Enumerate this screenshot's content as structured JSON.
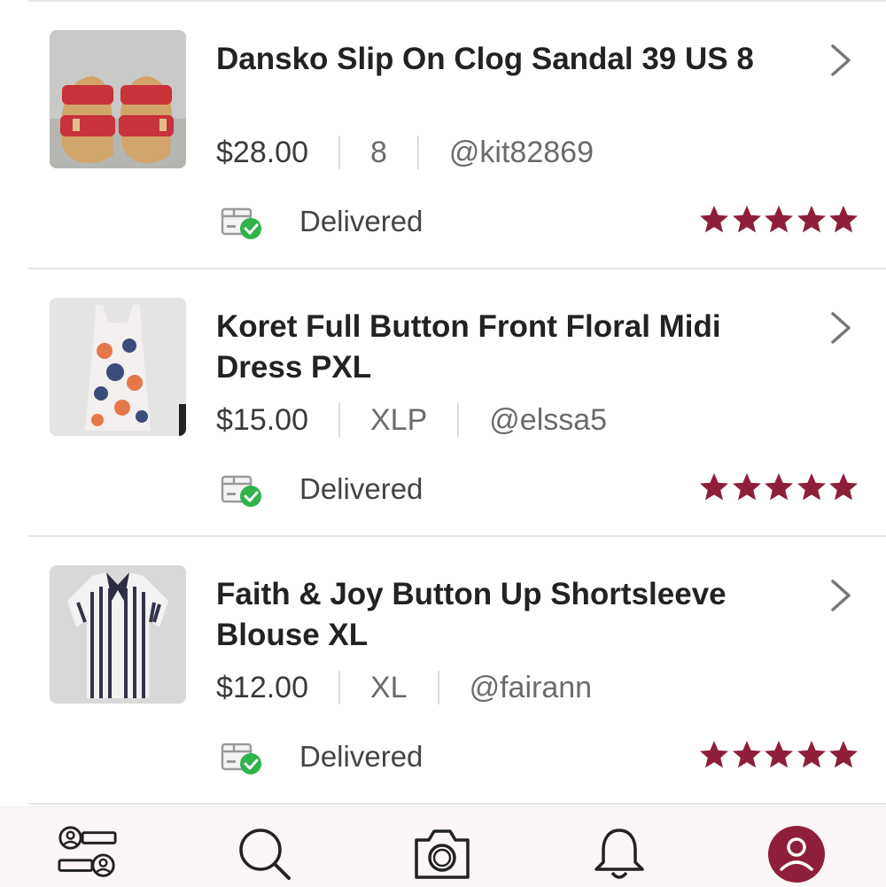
{
  "orders": [
    {
      "title": "Dansko Slip On Clog Sandal 39 US 8",
      "price": "$28.00",
      "size": "8",
      "seller": "@kit82869",
      "status": "Delivered",
      "rating": 5
    },
    {
      "title": "Koret Full Button Front Floral Midi Dress PXL",
      "price": "$15.00",
      "size": "XLP",
      "seller": "@elssa5",
      "status": "Delivered",
      "rating": 5
    },
    {
      "title": "Faith & Joy Button Up Shortsleeve Blouse XL",
      "price": "$12.00",
      "size": "XL",
      "seller": "@fairann",
      "status": "Delivered",
      "rating": 5
    }
  ],
  "colors": {
    "star": "#8e1f3a",
    "delivered_check": "#2fb34a",
    "active_tab": "#8e1f3a"
  },
  "icons": {
    "row": [
      "product-thumbnail",
      "chevron-right-icon",
      "delivered-box-icon",
      "star-icon"
    ],
    "tabbar": [
      "feed-icon",
      "search-icon",
      "camera-icon",
      "bell-icon",
      "profile-icon"
    ]
  }
}
